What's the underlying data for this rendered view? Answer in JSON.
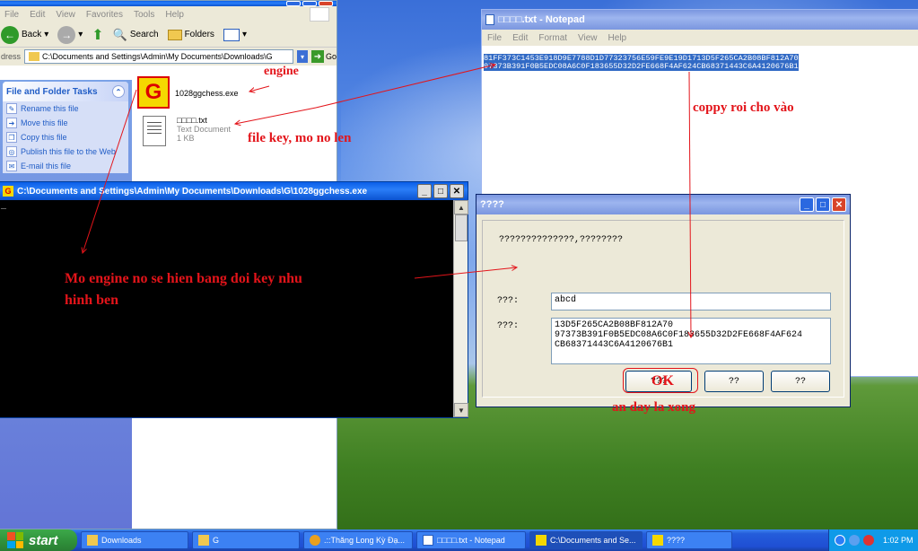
{
  "explorer": {
    "menu": [
      "File",
      "Edit",
      "View",
      "Favorites",
      "Tools",
      "Help"
    ],
    "toolbar": {
      "back": "Back",
      "search": "Search",
      "folders": "Folders"
    },
    "address": {
      "label": "dress",
      "value": "C:\\Documents and Settings\\Admin\\My Documents\\Downloads\\G",
      "go": "Go"
    },
    "tasks": {
      "title": "File and Folder Tasks",
      "items": [
        "Rename this file",
        "Move this file",
        "Copy this file",
        "Publish this file to the Web",
        "E-mail this file"
      ]
    },
    "files": [
      {
        "name": "1028ggchess.exe",
        "icon_letter": "G"
      },
      {
        "name": "□□□□.txt",
        "type": "Text Document",
        "size": "1 KB"
      }
    ]
  },
  "console": {
    "title": "C:\\Documents and Settings\\Admin\\My Documents\\Downloads\\G\\1028ggchess.exe",
    "icon_letter": "G",
    "cursor": "_"
  },
  "notepad": {
    "title": "□□□□.txt - Notepad",
    "menu": [
      "File",
      "Edit",
      "Format",
      "View",
      "Help"
    ],
    "lines": [
      "81FF373C1453E918D9E7788D1D77323756E59FE9E19D1713D5F265CA2B08BF812A70",
      "97373B391F0B5EDC08A6C0F183655D32D2FE668F4AF624CB68371443C6A4120676B1"
    ]
  },
  "dialog": {
    "title": "????",
    "prompt": "??????????????,????????",
    "field1_label": "???:",
    "field1_value": "abcd",
    "field2_label": "???:",
    "field2_lines": [
      "13D5F265CA2B08BF812A70",
      "97373B391F0B5EDC08A6C0F183655D32D2FE668F4AF624",
      "CB68371443C6A4120676B1"
    ],
    "buttons": [
      "???",
      "??",
      "??"
    ]
  },
  "annotations": {
    "engine": "engine",
    "file_key": "file key, mo no len",
    "copy": "coppy roi cho vào",
    "mo_engine_1": "Mo engine no se hien bang doi key nhu",
    "mo_engine_2": "hinh ben",
    "ok": "OK",
    "done": "an day la xong"
  },
  "taskbar": {
    "start": "start",
    "items": [
      "Downloads",
      "G",
      ".::Thăng Long Kỳ Đạ...",
      "□□□□.txt - Notepad",
      "C:\\Documents and Se...",
      "????"
    ],
    "clock": "1:02 PM"
  },
  "colors": {
    "annotation": "#e3141a",
    "selection": "#316ac5"
  }
}
